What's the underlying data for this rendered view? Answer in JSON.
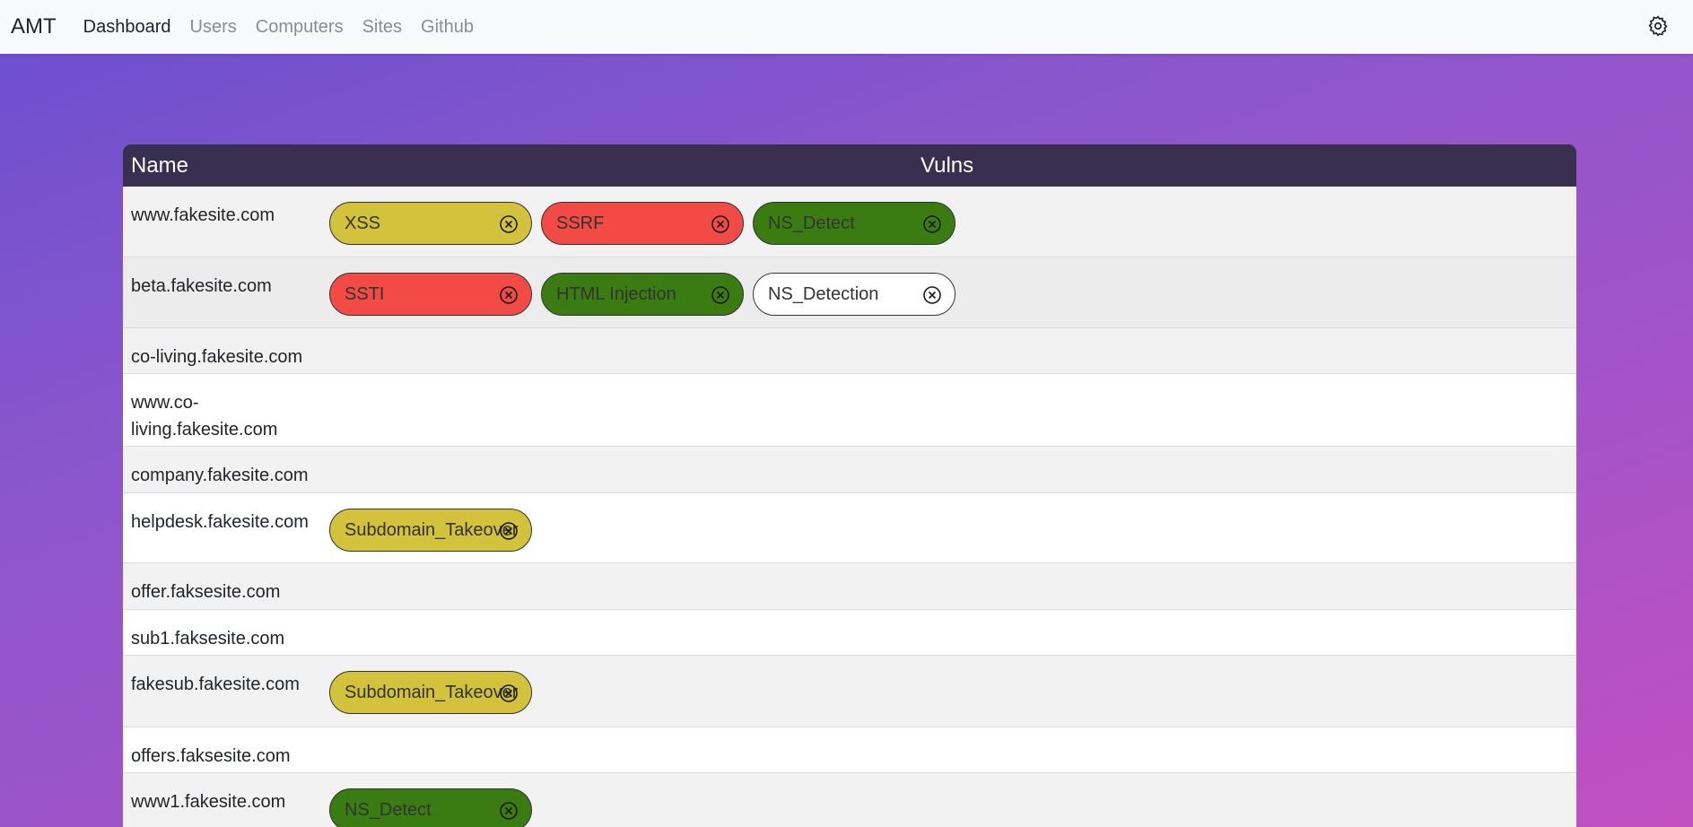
{
  "nav": {
    "brand": "AMT",
    "links": [
      "Dashboard",
      "Users",
      "Computers",
      "Sites",
      "Github"
    ],
    "settings_icon": "gear-icon"
  },
  "table": {
    "headers": {
      "name": "Name",
      "vulns": "Vulns"
    },
    "rows": [
      {
        "name": "www.fakesite.com",
        "vulns": [
          {
            "label": "XSS",
            "color": "#d2c23c"
          },
          {
            "label": "SSRF",
            "color": "#f24a44"
          },
          {
            "label": "NS_Detect",
            "color": "#3a7c12"
          }
        ]
      },
      {
        "name": "beta.fakesite.com",
        "vulns": [
          {
            "label": "SSTI",
            "color": "#f24a44"
          },
          {
            "label": "HTML Injection",
            "color": "#3a7c12"
          },
          {
            "label": "NS_Detection",
            "color": "#ffffff"
          }
        ]
      },
      {
        "name": "co-living.fakesite.com",
        "vulns": []
      },
      {
        "name": "www.co-living.fakesite.com",
        "vulns": []
      },
      {
        "name": "company.fakesite.com",
        "vulns": []
      },
      {
        "name": "helpdesk.fakesite.com",
        "vulns": [
          {
            "label": "Subdomain_Takeover",
            "color": "#d2c23c"
          }
        ]
      },
      {
        "name": "offer.faksesite.com",
        "vulns": []
      },
      {
        "name": "sub1.faksesite.com",
        "vulns": []
      },
      {
        "name": "fakesub.fakesite.com",
        "vulns": [
          {
            "label": "Subdomain_Takeover",
            "color": "#d2c23c"
          }
        ]
      },
      {
        "name": "offers.faksesite.com",
        "vulns": []
      },
      {
        "name": "www1.fakesite.com",
        "vulns": [
          {
            "label": "NS_Detect",
            "color": "#3a7c12"
          }
        ]
      }
    ]
  }
}
